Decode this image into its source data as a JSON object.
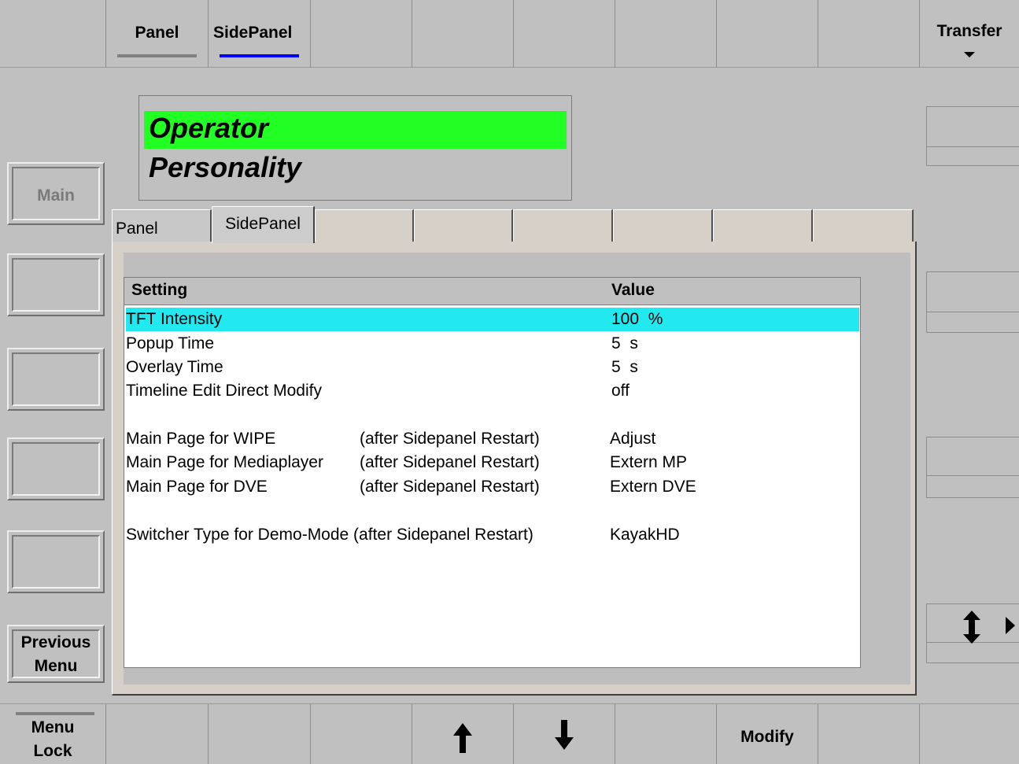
{
  "top_bar": {
    "panel_label": "Panel",
    "sidepanel_label": "SidePanel",
    "transfer_label": "Transfer"
  },
  "header": {
    "line1": "Operator",
    "line2": "Personality"
  },
  "left_keys": {
    "main_label": "Main",
    "previous_menu_line1": "Previous",
    "previous_menu_line2": "Menu"
  },
  "tabs": [
    "Panel",
    "SidePanel"
  ],
  "table": {
    "columns": [
      "Setting",
      "Value"
    ],
    "rows": [
      {
        "setting": "TFT Intensity",
        "note": "",
        "value": "100  %"
      },
      {
        "setting": "Popup Time",
        "note": "",
        "value": "5  s"
      },
      {
        "setting": "Overlay Time",
        "note": "",
        "value": "5  s"
      },
      {
        "setting": "Timeline Edit Direct Modify",
        "note": "",
        "value": "off"
      },
      {
        "setting": "Main Page for WIPE",
        "note": "(after Sidepanel Restart)",
        "value": "Adjust"
      },
      {
        "setting": "Main Page for Mediaplayer",
        "note": "(after Sidepanel Restart)",
        "value": "Extern MP"
      },
      {
        "setting": "Main Page for DVE",
        "note": "(after Sidepanel Restart)",
        "value": "Extern DVE"
      },
      {
        "setting": "Switcher Type for Demo-Mode (after Sidepanel Restart)",
        "note": "",
        "value": "KayakHD"
      }
    ]
  },
  "bottom_bar": {
    "menu_lock_line1": "Menu",
    "menu_lock_line2": "Lock",
    "modify_label": "Modify"
  },
  "colors": {
    "header_highlight": "#22ff22",
    "selected_row": "#22e8f0",
    "active_tab_indicator": "#0000ff",
    "inactive_tab_indicator": "#808080"
  },
  "icons": {
    "transfer": "triangle-down-icon",
    "scroll_up": "arrow-up-icon",
    "scroll_down": "arrow-down-icon",
    "resize": "up-down-arrow-icon",
    "expand": "triangle-right-icon"
  }
}
